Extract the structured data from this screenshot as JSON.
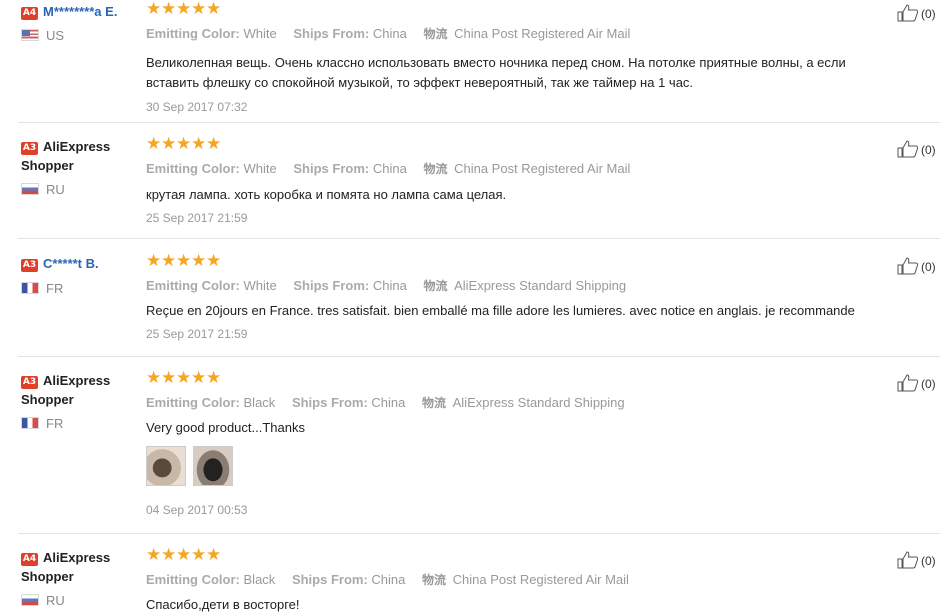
{
  "reviews": [
    {
      "level": "A4",
      "user_name": "M********a E.",
      "country": "US",
      "flag": "us",
      "rating": 5,
      "attrs": {
        "color_label": "Emitting Color:",
        "color_value": "White",
        "ships_label": "Ships From:",
        "ships_value": "China",
        "logistics_label": "物流",
        "logistics_value": "China Post Registered Air Mail"
      },
      "text": "Великолепная вещь. Очень классно использовать вместо ночника перед сном. На потолке приятные волны, а если вставить флешку со спокойной музыкой, то эффект невероятный, так же таймер на 1 час.",
      "date": "30 Sep 2017 07:32",
      "helpful": "(0)"
    },
    {
      "level": "A3",
      "user_name": "AliExpress Shopper",
      "country": "RU",
      "flag": "ru",
      "rating": 5,
      "attrs": {
        "color_label": "Emitting Color:",
        "color_value": "White",
        "ships_label": "Ships From:",
        "ships_value": "China",
        "logistics_label": "物流",
        "logistics_value": "China Post Registered Air Mail"
      },
      "text": "крутая лампа. хоть коробка и помята но лампа сама целая.",
      "date": "25 Sep 2017 21:59",
      "helpful": "(0)"
    },
    {
      "level": "A3",
      "user_name": "C*****t B.",
      "country": "FR",
      "flag": "fr",
      "rating": 5,
      "attrs": {
        "color_label": "Emitting Color:",
        "color_value": "White",
        "ships_label": "Ships From:",
        "ships_value": "China",
        "logistics_label": "物流",
        "logistics_value": "AliExpress Standard Shipping"
      },
      "text": "Reçue en 20jours en France. tres satisfait. bien emballé ma fille adore les lumieres. avec notice en anglais. je recommande",
      "date": "25 Sep 2017 21:59",
      "helpful": "(0)"
    },
    {
      "level": "A3",
      "user_name": "AliExpress Shopper",
      "country": "FR",
      "flag": "fr",
      "rating": 5,
      "attrs": {
        "color_label": "Emitting Color:",
        "color_value": "Black",
        "ships_label": "Ships From:",
        "ships_value": "China",
        "logistics_label": "物流",
        "logistics_value": "AliExpress Standard Shipping"
      },
      "text": "Very good product...Thanks",
      "date": "04 Sep 2017 00:53",
      "helpful": "(0)"
    },
    {
      "level": "A4",
      "user_name": "AliExpress Shopper",
      "country": "RU",
      "flag": "ru",
      "rating": 5,
      "attrs": {
        "color_label": "Emitting Color:",
        "color_value": "Black",
        "ships_label": "Ships From:",
        "ships_value": "China",
        "logistics_label": "物流",
        "logistics_value": "China Post Registered Air Mail"
      },
      "text": "Спасибо,дети в восторге!",
      "date": "",
      "helpful": "(0)"
    }
  ],
  "icons": {
    "star": "star-icon",
    "helpful": "thumbs-up-icon"
  },
  "colors": {
    "star": "#f5a623",
    "level_badge": "#e0402a",
    "user_link": "#2a64b8"
  }
}
